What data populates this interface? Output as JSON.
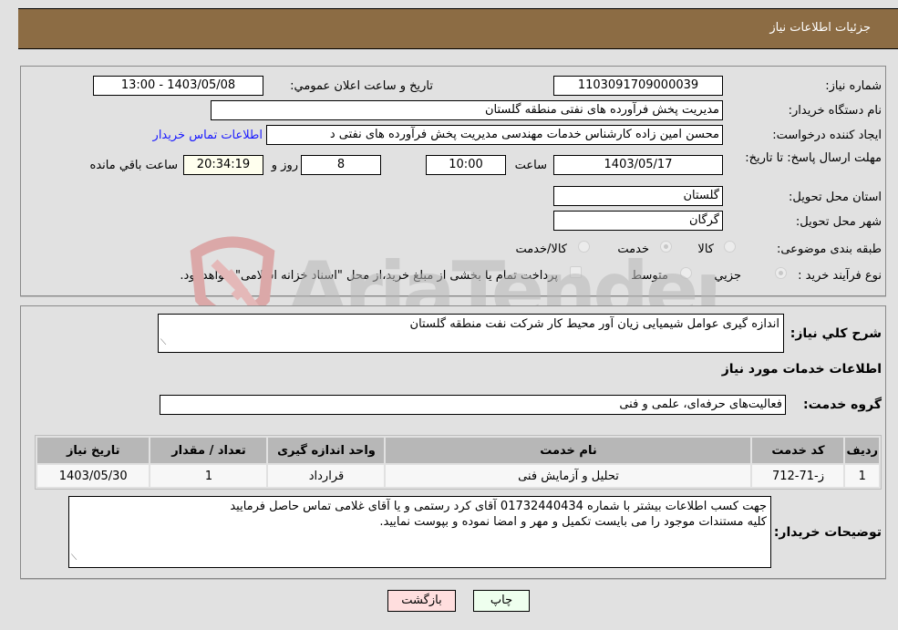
{
  "header": {
    "title": "جزئیات اطلاعات نیاز"
  },
  "details": {
    "need_number_label": "شماره نیاز:",
    "need_number": "1103091709000039",
    "announce_label": "تاریخ و ساعت اعلان عمومي:",
    "announce_value": "1403/05/08 - 13:00",
    "buyer_org_label": "نام دستگاه خریدار:",
    "buyer_org": "مدیریت پخش فرآورده های نفتی منطقه گلستان",
    "creator_label": "ایجاد کننده درخواست:",
    "creator": "محسن امین زاده کارشناس خدمات مهندسی مدیریت پخش فرآورده های نفتی د",
    "contact_link": "اطلاعات تماس خریدار",
    "deadline_label": "مهلت ارسال پاسخ: تا تاریخ:",
    "deadline_date": "1403/05/17",
    "time_label": "ساعت",
    "deadline_time": "10:00",
    "days_value": "8",
    "days_label": "روز و",
    "remaining_time": "20:34:19",
    "remaining_label": "ساعت باقي مانده",
    "province_label": "استان محل تحویل:",
    "province": "گلستان",
    "city_label": "شهر محل تحویل:",
    "city": "گرگان",
    "category_label": "طبقه بندی موضوعی:",
    "category_options": [
      {
        "label": "کالا",
        "checked": false
      },
      {
        "label": "خدمت",
        "checked": true
      },
      {
        "label": "کالا/خدمت",
        "checked": false
      }
    ],
    "process_label": "نوع فرآیند خرید :",
    "process_options": [
      {
        "label": "جزيي",
        "checked": true
      },
      {
        "label": "متوسط",
        "checked": false
      }
    ],
    "treasury_note": "پرداخت تمام یا بخشی از مبلغ خرید،از محل \"اسناد خزانه اسلامی\" خواهد بود."
  },
  "description": {
    "label": "شرح کلي نياز:",
    "value": "اندازه گیری عوامل شیمیایی زیان آور محیط کار شرکت نفت منطقه گلستان",
    "services_heading": "اطلاعات خدمات مورد نياز",
    "service_group_label": "گروه خدمت:",
    "service_group": "فعالیت‌های حرفه‌ای، علمی و فنی"
  },
  "table": {
    "headers": [
      "رديف",
      "کد خدمت",
      "نام خدمت",
      "واحد اندازه گيری",
      "تعداد / مقدار",
      "تاريخ نياز"
    ],
    "rows": [
      [
        "1",
        "ز-71-712",
        "تحلیل و آزمایش فنی",
        "قرارداد",
        "1",
        "1403/05/30"
      ]
    ]
  },
  "buyer_notes": {
    "label": "توضیحات خریدار:",
    "line1": "جهت کسب اطلاعات بیشتر با شماره 01732440434 آقای کرد رستمی و یا آقای غلامی تماس حاصل فرمایید",
    "line2": "کلیه مستندات موجود را می بایست تکمیل و مهر و امضا نموده و بپوست نمایید."
  },
  "buttons": {
    "print": "چاپ",
    "back": "بازگشت"
  },
  "watermark": {
    "text": "AriaTender.neT"
  },
  "colors": {
    "header_bg": "#8c6c44",
    "print_bg": "#eeffee",
    "back_bg": "#ffdede",
    "link": "#1a1aff"
  }
}
